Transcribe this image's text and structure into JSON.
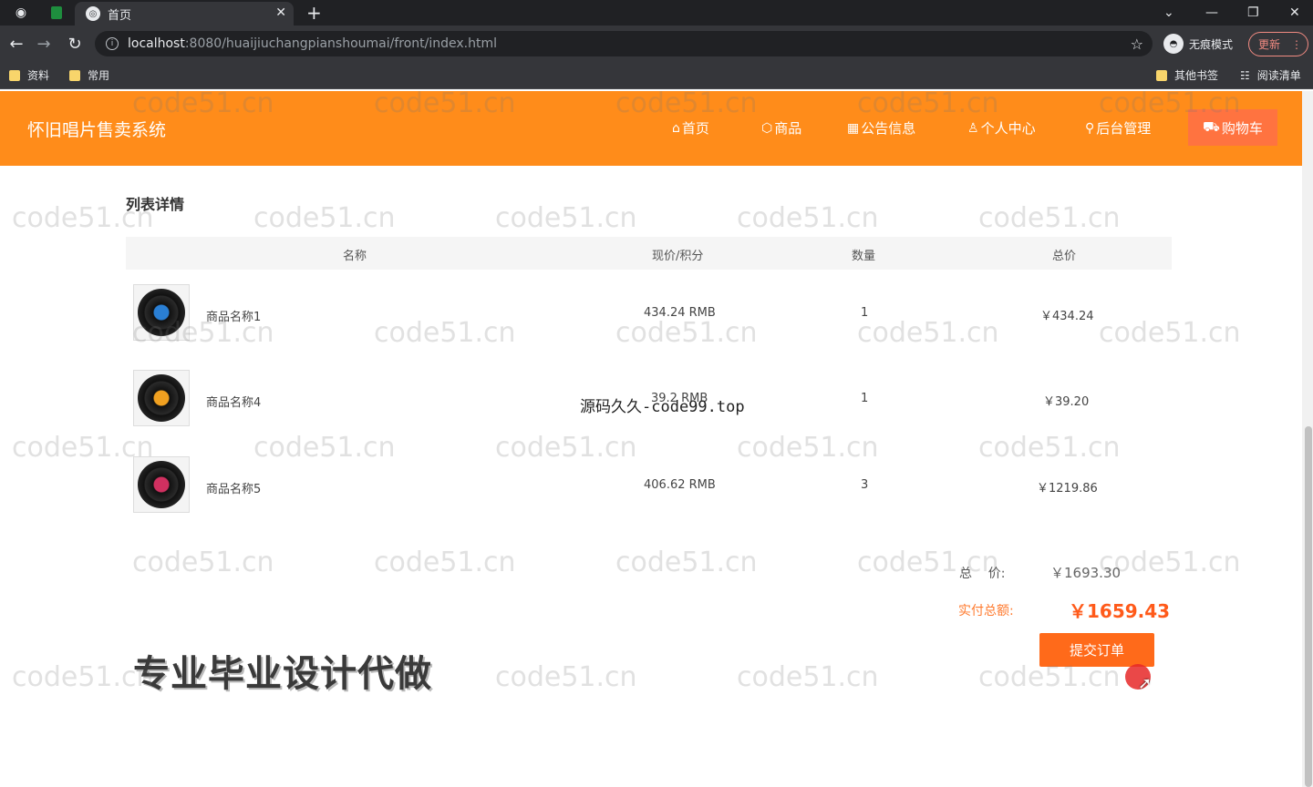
{
  "browser": {
    "tab_title": "首页",
    "url_host": "localhost",
    "url_path": ":8080/huaijiuchangpianshoumai/front/index.html",
    "incognito_label": "无痕模式",
    "update_label": "更新",
    "bookmarks": [
      "资料",
      "常用"
    ],
    "bookmarks_right": [
      "其他书签",
      "阅读清单"
    ]
  },
  "site": {
    "title": "怀旧唱片售卖系统",
    "nav": [
      {
        "icon": "home-icon",
        "label": "首页"
      },
      {
        "icon": "goods-icon",
        "label": "商品"
      },
      {
        "icon": "notice-icon",
        "label": "公告信息"
      },
      {
        "icon": "user-icon",
        "label": "个人中心"
      },
      {
        "icon": "admin-icon",
        "label": "后台管理"
      },
      {
        "icon": "cart-icon",
        "label": "购物车"
      }
    ]
  },
  "cart": {
    "section_title": "列表详情",
    "headers": [
      "名称",
      "现价/积分",
      "数量",
      "总价"
    ],
    "rows": [
      {
        "name": "商品名称1",
        "price": "434.24 RMB",
        "qty": "1",
        "total": "￥434.24",
        "disc_color": "#2a7fd4"
      },
      {
        "name": "商品名称4",
        "price": "39.2 RMB",
        "qty": "1",
        "total": "￥39.20",
        "disc_color": "#f0a020"
      },
      {
        "name": "商品名称5",
        "price": "406.62 RMB",
        "qty": "3",
        "total": "￥1219.86",
        "disc_color": "#d03060"
      }
    ],
    "sum_label": "总    价:",
    "sum_value": "￥1693.30",
    "pay_label": "实付总额:",
    "pay_value": "￥1659.43",
    "submit_label": "提交订单"
  },
  "overlays": {
    "center_text": "源码久久-code99.top",
    "promo_text": "专业毕业设计代做",
    "watermark": "code51.cn"
  }
}
